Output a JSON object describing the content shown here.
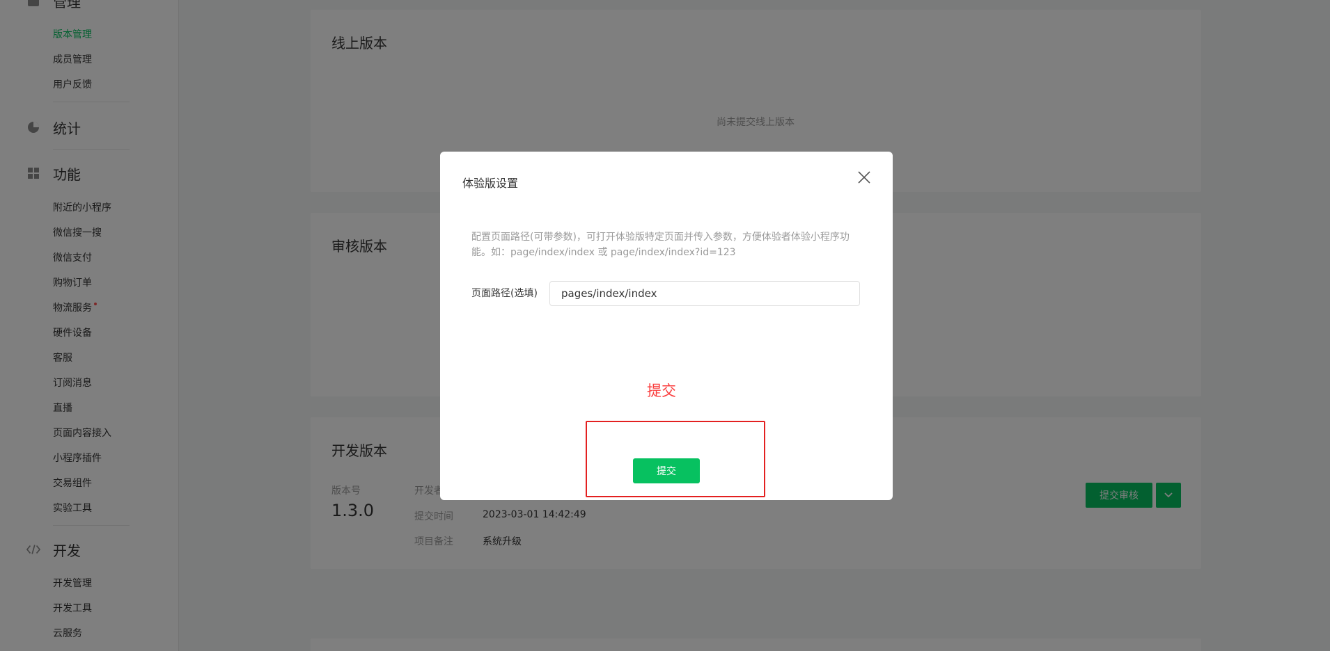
{
  "sidebar": {
    "section_manage": "管理",
    "manage_items": [
      "版本管理",
      "成员管理",
      "用户反馈"
    ],
    "section_stats": "统计",
    "section_features": "功能",
    "feature_items": [
      "附近的小程序",
      "微信搜一搜",
      "微信支付",
      "购物订单",
      "物流服务",
      "硬件设备",
      "客服",
      "订阅消息",
      "直播",
      "页面内容接入",
      "小程序插件",
      "交易组件",
      "实验工具"
    ],
    "section_dev": "开发",
    "dev_items": [
      "开发管理",
      "开发工具",
      "云服务"
    ]
  },
  "main": {
    "online": {
      "title": "线上版本",
      "empty": "尚未提交线上版本"
    },
    "review": {
      "title": "审核版本"
    },
    "dev": {
      "title": "开发版本",
      "version_label": "版本号",
      "version_value": "1.3.0",
      "developer_label": "开发者",
      "submit_time_label": "提交时间",
      "submit_time_value": "2023-03-01 14:42:49",
      "remark_label": "项目备注",
      "remark_value": "系统升级",
      "submit_review_btn": "提交审核"
    }
  },
  "dialog": {
    "title": "体验版设置",
    "description": "配置页面路径(可带参数)，可打开体验版特定页面并传入参数，方便体验者体验小程序功能。如：page/index/index 或 page/index/index?id=123",
    "path_label": "页面路径(选填)",
    "path_value": "pages/index/index",
    "annotation": "提交",
    "submit_label": "提交"
  },
  "colors": {
    "accent": "#07c160",
    "annotation_red": "#e32020"
  }
}
